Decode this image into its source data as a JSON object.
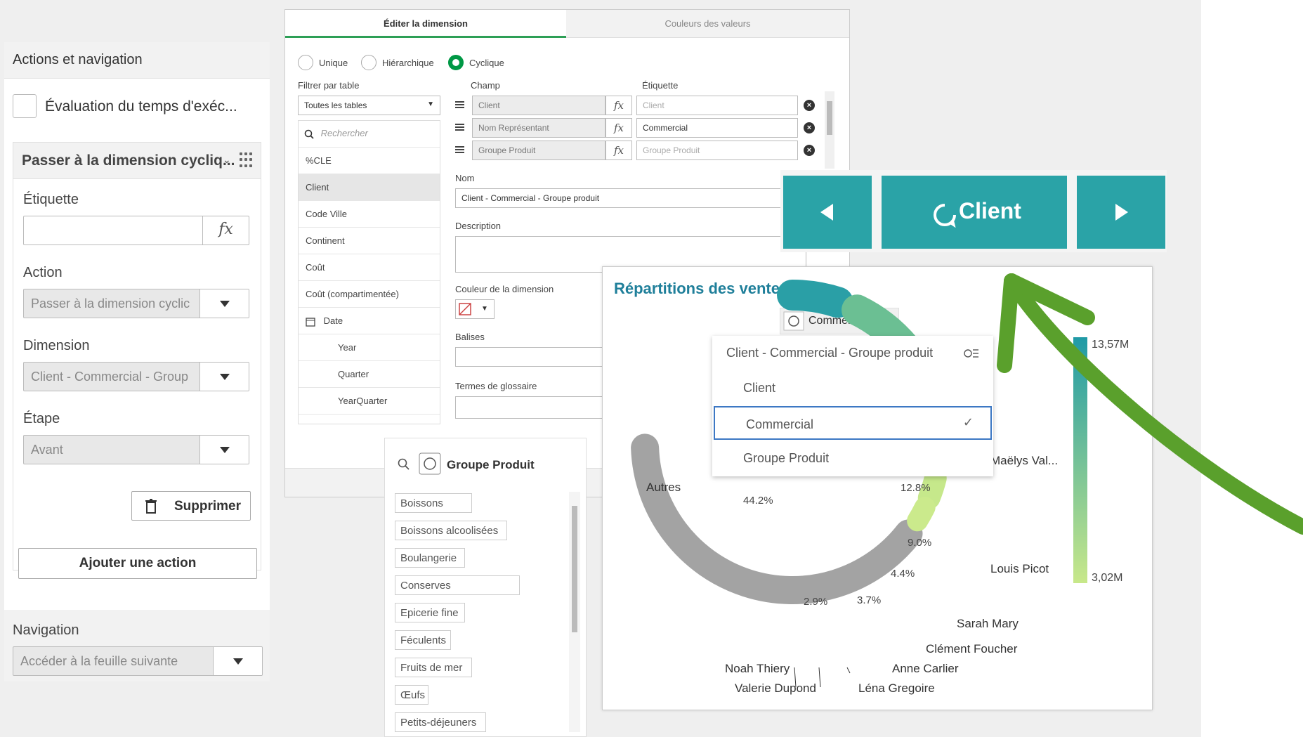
{
  "left_panel": {
    "section_title": "Actions et navigation",
    "eval_label": "Évaluation du temps d'exéc...",
    "action_title": "Passer à la dimension cycliq...",
    "label_etiquette": "Étiquette",
    "label_action": "Action",
    "action_value": "Passer à la dimension cyclic",
    "label_dimension": "Dimension",
    "dimension_value": "Client - Commercial - Group",
    "label_etape": "Étape",
    "etape_value": "Avant",
    "delete_button": "Supprimer",
    "add_action_button": "Ajouter une action",
    "navigation_label": "Navigation",
    "navigation_value": "Accéder à la feuille suivante",
    "fx": "fx"
  },
  "dimension_editor": {
    "tabs": [
      "Éditer la dimension",
      "Couleurs des valeurs"
    ],
    "radios": [
      "Unique",
      "Hiérarchique",
      "Cyclique"
    ],
    "filter_label": "Filtrer par table",
    "filter_value": "Toutes les tables",
    "search_placeholder": "Rechercher",
    "fields": [
      "%CLE",
      "Client",
      "Code Ville",
      "Continent",
      "Coût",
      "Coût (compartimentée)",
      "Date",
      "Year",
      "Quarter",
      "YearQuarter"
    ],
    "champ_label": "Champ",
    "etiquette_label": "Étiquette",
    "rows": [
      {
        "champ": "Client",
        "etiquette": "Client"
      },
      {
        "champ": "Nom Représentant",
        "etiquette": "Commercial"
      },
      {
        "champ": "Groupe Produit",
        "etiquette": "Groupe Produit"
      }
    ],
    "nom_label": "Nom",
    "nom_value": "Client - Commercial - Groupe produit",
    "description_label": "Description",
    "couleur_label": "Couleur de la dimension",
    "balises_label": "Balises",
    "glossaire_label": "Termes de glossaire",
    "fx": "fx"
  },
  "nav_buttons": {
    "current": "Client"
  },
  "chart": {
    "title": "Répartitions des ventes",
    "dropdown_value": "Commercial",
    "dropdown_header": "Client - Commercial - Groupe produit",
    "dropdown_options": [
      "Client",
      "Commercial",
      "Groupe Produit"
    ],
    "legend_max": "13,57M",
    "legend_min": "3,02M",
    "colors": {
      "teal": "#2aa3a7",
      "green_light": "#c5e88a",
      "grey": "#9e9e9e",
      "title": "#1f7f9a"
    }
  },
  "chart_data": {
    "type": "pie",
    "title": "Répartitions des ventes",
    "labels": [
      "Autres",
      "Maëlys Val...",
      "Louis Picot",
      "Sarah Mary",
      "Clément Foucher",
      "Anne Carlier",
      "Léna Gregoire",
      "Valerie Dupond",
      "Noah Thiery"
    ],
    "percent_labels": [
      "44.2%",
      "12.8%",
      "9.0%",
      "4.4%",
      "3.7%",
      "2.9%"
    ],
    "values_percent": [
      44.2,
      12.8,
      9.0,
      4.4,
      3.7,
      2.9
    ],
    "color_scale": {
      "min": "3,02M",
      "max": "13,57M"
    }
  },
  "groupe_produit": {
    "title": "Groupe Produit",
    "items": [
      "Boissons",
      "Boissons alcoolisées",
      "Boulangerie",
      "Conserves",
      "Epicerie fine",
      "Féculents",
      "Fruits de mer",
      "Œufs",
      "Petits-déjeuners"
    ]
  }
}
